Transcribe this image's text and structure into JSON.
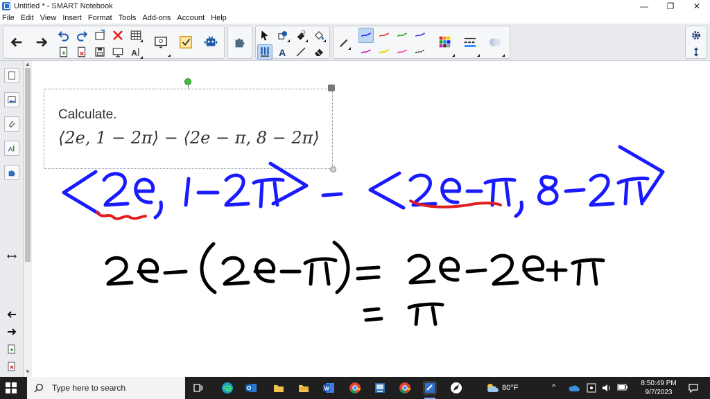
{
  "window": {
    "title": "Untitled * - SMART Notebook",
    "minimize": "—",
    "restore": "❐",
    "close": "✕"
  },
  "menu": [
    "File",
    "Edit",
    "View",
    "Insert",
    "Format",
    "Tools",
    "Add-ons",
    "Account",
    "Help"
  ],
  "canvas": {
    "textbox": {
      "heading": "Calculate.",
      "expression": "⟨2e, 1 − 2π⟩ − ⟨2e − π, 8 − 2π⟩"
    },
    "colors": {
      "blue_ink": "#1a1aff",
      "red_ink": "#e02020",
      "black_ink": "#000000"
    }
  },
  "taskbar": {
    "search_placeholder": "Type here to search",
    "weather": "80°F",
    "time": "8:50:49 PM",
    "date": "9/7/2023"
  }
}
